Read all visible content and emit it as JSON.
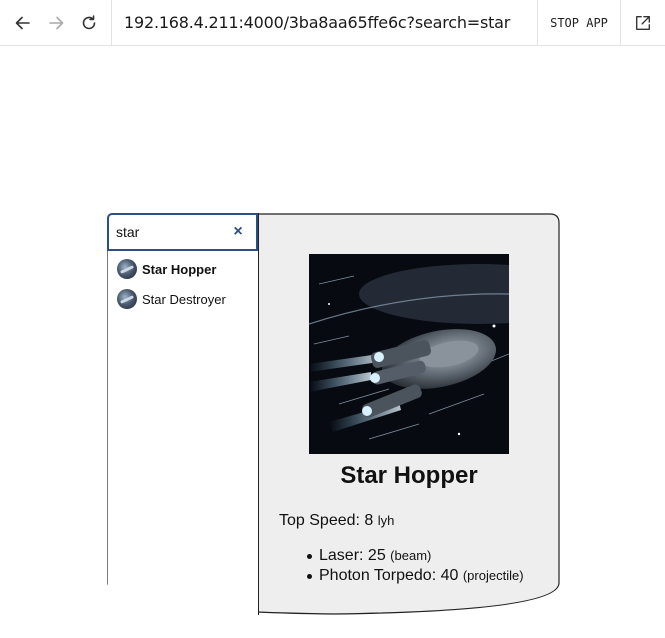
{
  "browser": {
    "url": "192.168.4.211:4000/3ba8aa65ffe6c?search=star",
    "stop_label": "STOP APP"
  },
  "search": {
    "value": "star",
    "clear_label": "×"
  },
  "results": [
    {
      "name": "Star Hopper",
      "active": true
    },
    {
      "name": "Star Destroyer",
      "active": false
    }
  ],
  "detail": {
    "name": "Star Hopper",
    "speed_label": "Top Speed:",
    "speed_value": "8",
    "speed_unit": "lyh",
    "weapons": [
      {
        "name": "Laser:",
        "damage": "25",
        "type": "(beam)"
      },
      {
        "name": "Photon Torpedo:",
        "damage": "40",
        "type": "(projectile)"
      }
    ]
  },
  "colors": {
    "accent": "#2c4f86",
    "detail_background": "#eeeeee",
    "border": "#222222"
  }
}
